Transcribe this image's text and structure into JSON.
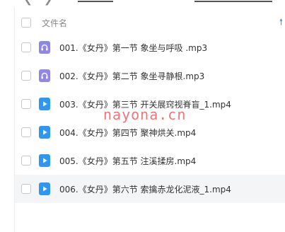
{
  "header": {
    "column_name": "文件名",
    "sort_icon": "sort-ascending-icon"
  },
  "files": [
    {
      "name": "001.《女丹》第一节 象坐与呼吸 .mp3",
      "icon": "audio-file-icon"
    },
    {
      "name": "002.《女丹》第二节 象坐寻静根.mp3",
      "icon": "audio-file-icon"
    },
    {
      "name": "003.《女丹》第三节 开关展窍视脊盲_1.mp4",
      "icon": "video-file-icon"
    },
    {
      "name": "004.《女丹》第四节 聚神烘关.mp4",
      "icon": "video-file-icon"
    },
    {
      "name": "005.《女丹》第五节 注溪揉房.mp4",
      "icon": "video-file-icon"
    },
    {
      "name": "006.《女丹》第六节 索擒赤龙化泥液_1.mp4",
      "icon": "video-file-icon"
    }
  ],
  "watermark": "nayona.cn",
  "colors": {
    "audio_icon": "#8f86e6",
    "video_icon": "#2f97ef",
    "highlight_row": "#f4f5f7",
    "watermark": "#e25252"
  }
}
